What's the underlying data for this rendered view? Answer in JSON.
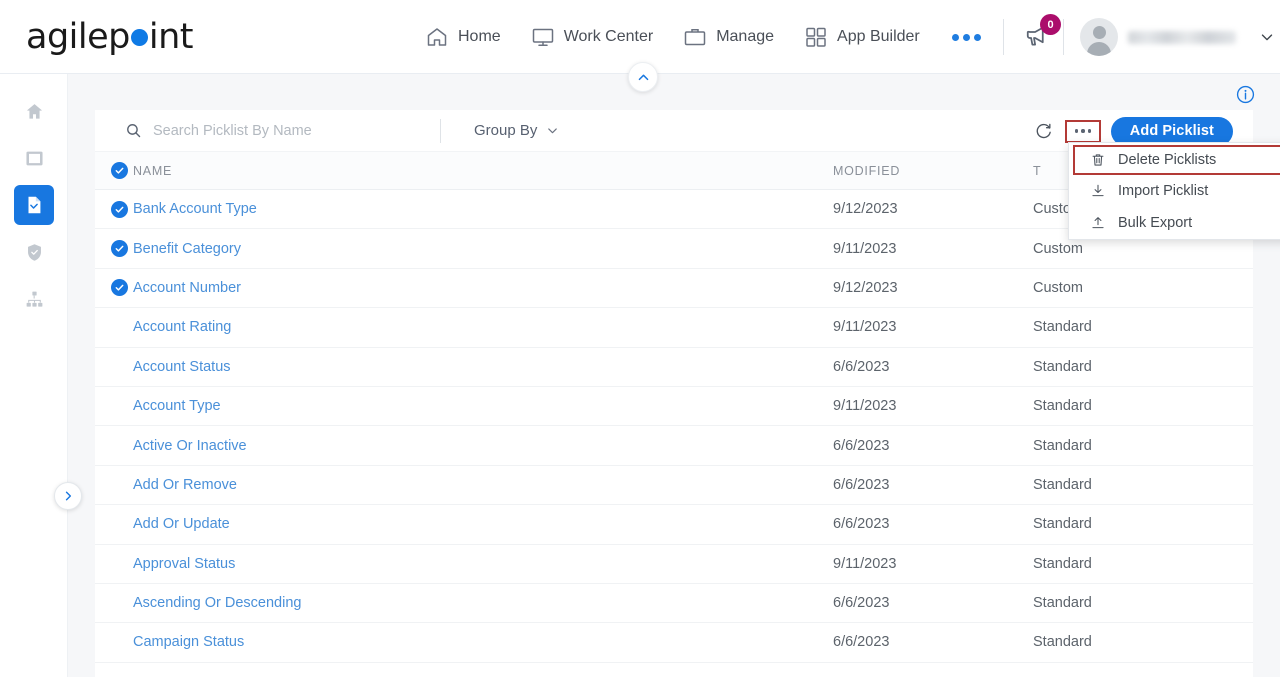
{
  "brand": {
    "name_a": "agilep",
    "dot": "o",
    "name_b": "int",
    "logo_color": "#0f7ae5"
  },
  "topnav": {
    "items": [
      {
        "label": "Home",
        "icon": "home-icon"
      },
      {
        "label": "Work Center",
        "icon": "monitor-icon"
      },
      {
        "label": "Manage",
        "icon": "briefcase-icon"
      },
      {
        "label": "App Builder",
        "icon": "grid-icon"
      }
    ],
    "more_label": "•••",
    "notification_count": "0",
    "notification_badge_color": "#ab0d6b",
    "user_name": ""
  },
  "sidebar": {
    "items": [
      {
        "icon": "home-icon",
        "active": false
      },
      {
        "icon": "monitor-icon",
        "active": false
      },
      {
        "icon": "document-icon",
        "active": true
      },
      {
        "icon": "shield-check-icon",
        "active": false
      },
      {
        "icon": "org-chart-icon",
        "active": false
      }
    ],
    "expand_icon": "chevron-right-icon"
  },
  "page": {
    "collapse_icon": "chevron-up-icon",
    "info_icon": "info-circle-icon"
  },
  "toolbar": {
    "search_placeholder": "Search Picklist By Name",
    "search_value": "",
    "search_icon": "search-icon",
    "group_by_label": "Group By",
    "group_by_icon": "chevron-down-icon",
    "refresh_icon": "refresh-icon",
    "ellipsis_label": "...",
    "add_label": "Add Picklist",
    "accent_color": "#1877e0",
    "highlight_color": "#b33a36"
  },
  "menu": {
    "items": [
      {
        "label": "Delete Picklists",
        "icon": "trash-icon",
        "highlighted": true
      },
      {
        "label": "Import Picklist",
        "icon": "download-icon",
        "highlighted": false
      },
      {
        "label": "Bulk Export",
        "icon": "upload-icon",
        "highlighted": false
      }
    ]
  },
  "table": {
    "headers": {
      "name": "NAME",
      "modified": "MODIFIED",
      "type": "T"
    },
    "header_checked": true,
    "rows": [
      {
        "name": "Bank Account Type",
        "modified": "9/12/2023",
        "type": "Custom",
        "checked": true
      },
      {
        "name": "Benefit Category",
        "modified": "9/11/2023",
        "type": "Custom",
        "checked": true
      },
      {
        "name": "Account Number",
        "modified": "9/12/2023",
        "type": "Custom",
        "checked": true
      },
      {
        "name": "Account Rating",
        "modified": "9/11/2023",
        "type": "Standard",
        "checked": false
      },
      {
        "name": "Account Status",
        "modified": "6/6/2023",
        "type": "Standard",
        "checked": false
      },
      {
        "name": "Account Type",
        "modified": "9/11/2023",
        "type": "Standard",
        "checked": false
      },
      {
        "name": "Active Or Inactive",
        "modified": "6/6/2023",
        "type": "Standard",
        "checked": false
      },
      {
        "name": "Add Or Remove",
        "modified": "6/6/2023",
        "type": "Standard",
        "checked": false
      },
      {
        "name": "Add Or Update",
        "modified": "6/6/2023",
        "type": "Standard",
        "checked": false
      },
      {
        "name": "Approval Status",
        "modified": "9/11/2023",
        "type": "Standard",
        "checked": false
      },
      {
        "name": "Ascending Or Descending",
        "modified": "6/6/2023",
        "type": "Standard",
        "checked": false
      },
      {
        "name": "Campaign Status",
        "modified": "6/6/2023",
        "type": "Standard",
        "checked": false
      }
    ]
  }
}
